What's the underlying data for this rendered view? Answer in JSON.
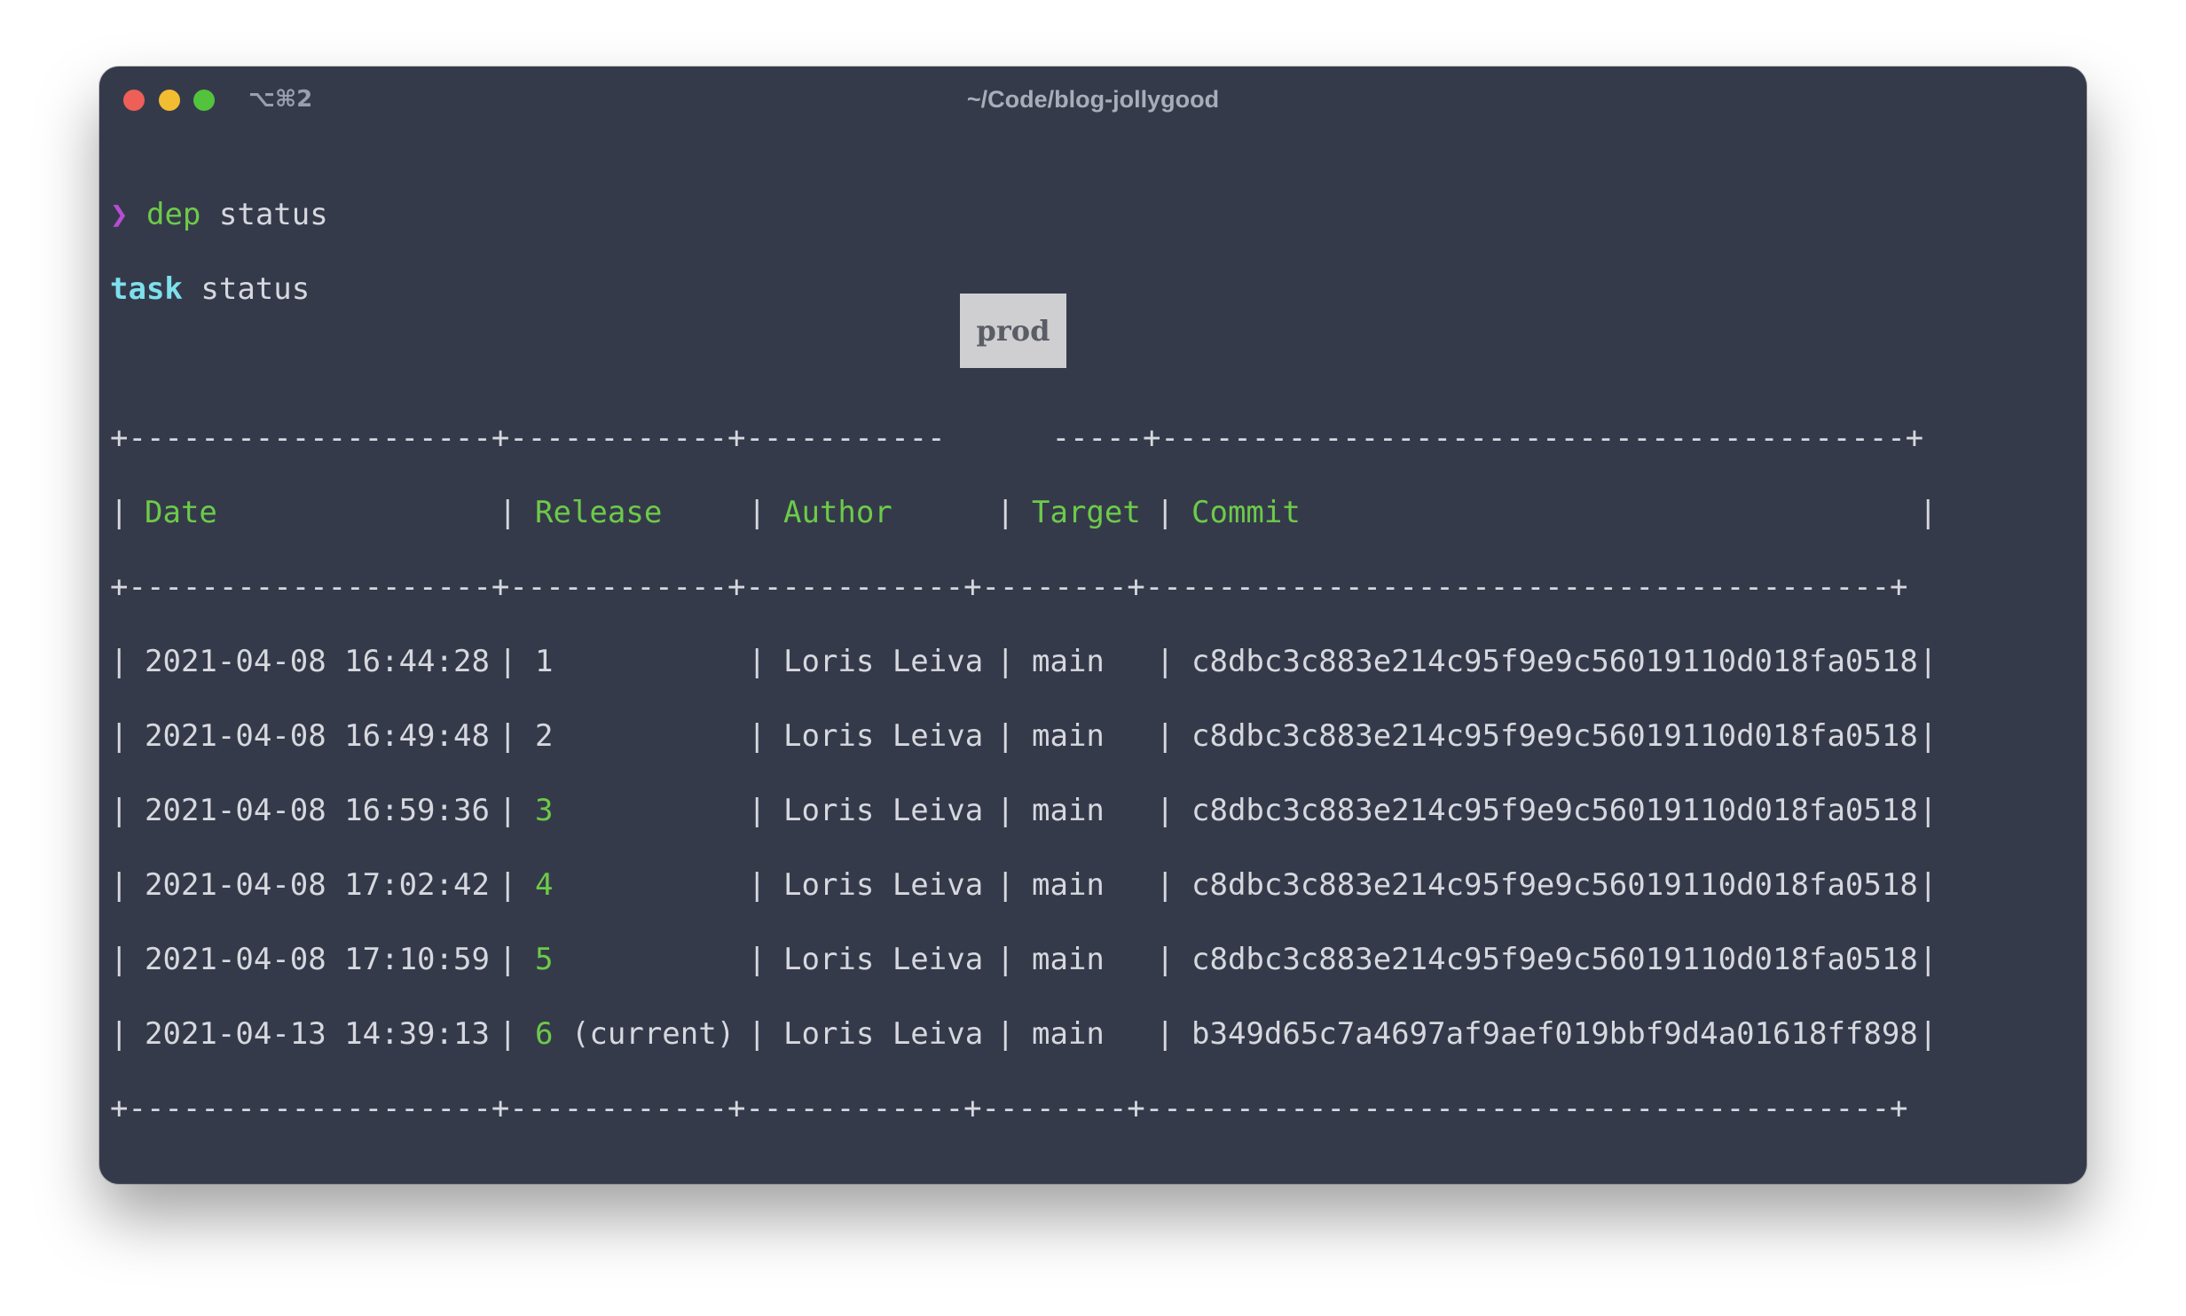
{
  "window": {
    "shortcut": "⌥⌘2",
    "title": "~/Code/blog-jollygood"
  },
  "prompt": {
    "symbol": "❯",
    "command": "dep",
    "argument": "status"
  },
  "task": {
    "label": "task",
    "name": "status"
  },
  "table": {
    "stage": "prod",
    "border_left": "+--------------------+------------+-----------",
    "border_right": "-----+-----------------------------------------+",
    "border_full": "+--------------------+------------+------------+--------+-----------------------------------------+",
    "separator": "|",
    "headers": {
      "date": "Date",
      "release": "Release",
      "author": "Author",
      "target": "Target",
      "commit": "Commit"
    },
    "rows": [
      {
        "date": "2021-04-08 16:44:28",
        "release": "1",
        "release_suffix": "",
        "author": "Loris Leiva",
        "target": "main",
        "commit": "c8dbc3c883e214c95f9e9c56019110d018fa0518"
      },
      {
        "date": "2021-04-08 16:49:48",
        "release": "2",
        "release_suffix": "",
        "author": "Loris Leiva",
        "target": "main",
        "commit": "c8dbc3c883e214c95f9e9c56019110d018fa0518"
      },
      {
        "date": "2021-04-08 16:59:36",
        "release": "3",
        "release_suffix": "",
        "author": "Loris Leiva",
        "target": "main",
        "commit": "c8dbc3c883e214c95f9e9c56019110d018fa0518"
      },
      {
        "date": "2021-04-08 17:02:42",
        "release": "4",
        "release_suffix": "",
        "author": "Loris Leiva",
        "target": "main",
        "commit": "c8dbc3c883e214c95f9e9c56019110d018fa0518"
      },
      {
        "date": "2021-04-08 17:10:59",
        "release": "5",
        "release_suffix": "",
        "author": "Loris Leiva",
        "target": "main",
        "commit": "c8dbc3c883e214c95f9e9c56019110d018fa0518"
      },
      {
        "date": "2021-04-13 14:39:13",
        "release": "6",
        "release_suffix": " (current)",
        "author": "Loris Leiva",
        "target": "main",
        "commit": "b349d65c7a4697af9aef019bbf9d4a01618ff898"
      }
    ]
  },
  "colors": {
    "background": "#353a4b",
    "text": "#d6d8de",
    "green": "#6ccb48",
    "cyan": "#7de0ed",
    "prompt": "#b84dd1",
    "badge_bg": "#cfcfd1"
  }
}
